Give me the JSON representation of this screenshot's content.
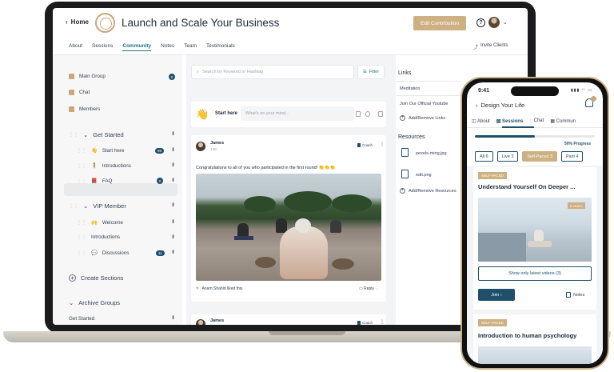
{
  "header": {
    "back_label": "Home",
    "title": "Launch and Scale Your Business",
    "edit_label": "Edit Contribution"
  },
  "tabs": [
    "About",
    "Sessions",
    "Community",
    "Notes",
    "Team",
    "Testimonials"
  ],
  "active_tab": "Community",
  "invite_label": "Invite Clients",
  "sidebar": {
    "top_items": [
      {
        "label": "Main Group",
        "badge": "0"
      },
      {
        "label": "Chat"
      },
      {
        "label": "Members"
      }
    ],
    "groups": [
      {
        "title": "Get Started",
        "items": [
          {
            "label": "Start here",
            "badge": "99"
          },
          {
            "label": "Introductions"
          },
          {
            "label": "FAQ",
            "badge": "0"
          }
        ]
      },
      {
        "title": "VIP Member",
        "items": [
          {
            "label": "Welcome"
          },
          {
            "label": "Introductions"
          },
          {
            "label": "Discussions",
            "badge": "11"
          }
        ]
      }
    ],
    "create_label": "Create Sections",
    "archive_title": "Archive Groups",
    "archive_item": "Get Started"
  },
  "feed": {
    "search_placeholder": "Search by Keyword or Hashtag",
    "filter_label": "Filter",
    "compose_label": "Start here",
    "compose_placeholder": "What's on your mind...",
    "post": {
      "author": "James",
      "time": "13m",
      "role": "Coach",
      "text": "Congratulations to all of you who participated in the first round! 👏👏👏",
      "liked_by": "Anam Shahid liked this",
      "reply_label": "Reply"
    },
    "post2": {
      "author": "James",
      "time": "13m",
      "role": "Coach"
    }
  },
  "right": {
    "links_title": "Links",
    "links": [
      "Meditation",
      "Join Our Official Youtube"
    ],
    "add_links": "Add/Remove Links",
    "resources_title": "Resources",
    "files": [
      "pexels-ming.jpg",
      "edit.png"
    ],
    "add_resources": "Add/Remove Resources"
  },
  "phone": {
    "time": "9:41",
    "back_title": "Design Your Life",
    "tabs": [
      "About",
      "Sessions",
      "Chat",
      "Commun"
    ],
    "progress_percent": 50,
    "progress_label": "50% Progress",
    "filters": [
      {
        "label": "All 6",
        "on": false
      },
      {
        "label": "Live 3",
        "on": false
      },
      {
        "label": "Self-Paced 3",
        "on": true
      },
      {
        "label": "Past 4",
        "on": false
      }
    ],
    "card1": {
      "badge": "SELF-PACED",
      "title": "Understand Yourself On Deeper ...",
      "video_badge": "8 VIDEO",
      "latest_label": "Show only latest videos (3)",
      "join_label": "Join",
      "notes_label": "Notes"
    },
    "card2": {
      "badge": "SELF-PACED",
      "title": "Introduction to human psychology"
    }
  },
  "colors": {
    "accent": "#cdb083",
    "primary": "#1f4f6b",
    "link": "#1f6f8b"
  }
}
